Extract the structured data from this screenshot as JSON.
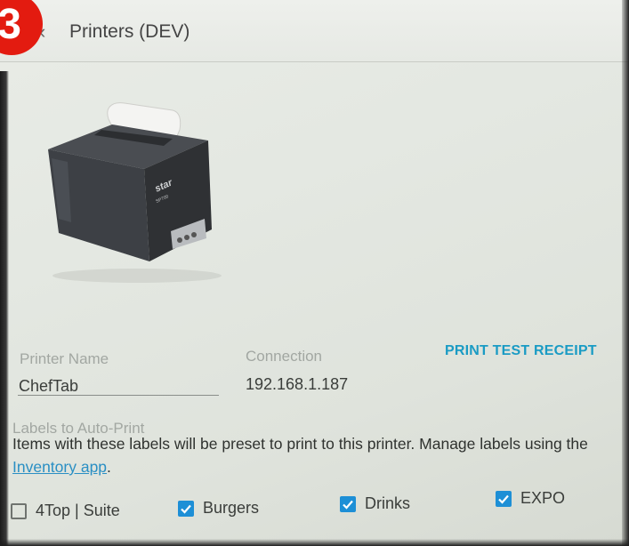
{
  "overlay": {
    "step_number": "3"
  },
  "header": {
    "title": "Printers (DEV)"
  },
  "printer": {
    "name_label": "Printer Name",
    "name_value": "ChefTab",
    "connection_label": "Connection",
    "connection_value": "192.168.1.187",
    "print_test_label": "PRINT TEST RECEIPT",
    "brand_mark": "star",
    "model_mark": "SP700"
  },
  "labels": {
    "section_title": "Labels to Auto-Print",
    "description_prefix": "Items with these labels will be preset to print to this printer. Manage labels using the",
    "description_link": "Inventory app",
    "description_suffix": ".",
    "items": [
      {
        "label": "4Top | Suite",
        "checked": false
      },
      {
        "label": "Burgers",
        "checked": true
      },
      {
        "label": "Drinks",
        "checked": true
      },
      {
        "label": "EXPO",
        "checked": true
      }
    ]
  },
  "colors": {
    "accent": "#1a9bc4",
    "checkbox": "#1d8fd6",
    "badge": "#e31b10"
  }
}
